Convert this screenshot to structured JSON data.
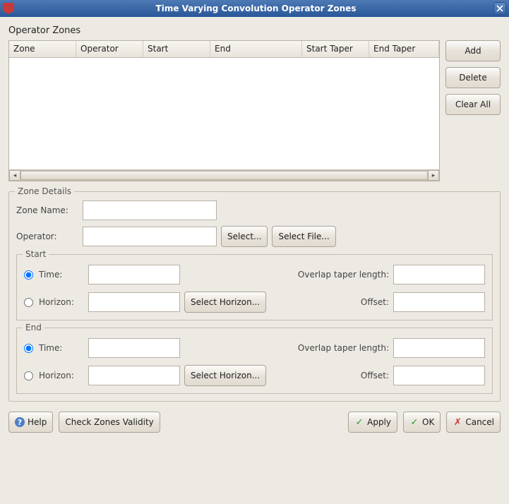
{
  "window": {
    "title": "Time Varying Convolution Operator Zones"
  },
  "operatorZones": {
    "label": "Operator Zones",
    "columns": {
      "zone": "Zone",
      "operator": "Operator",
      "start": "Start",
      "end": "End",
      "startTaper": "Start Taper",
      "endTaper": "End Taper"
    },
    "rows": [],
    "buttons": {
      "add": "Add",
      "delete": "Delete",
      "clearAll": "Clear All"
    }
  },
  "zoneDetails": {
    "legend": "Zone Details",
    "zoneName": {
      "label": "Zone Name:",
      "value": ""
    },
    "operator": {
      "label": "Operator:",
      "value": "",
      "selectBtn": "Select...",
      "selectFileBtn": "Select File..."
    },
    "start": {
      "legend": "Start",
      "timeLabel": "Time:",
      "timeValue": "",
      "timeSelected": true,
      "horizonLabel": "Horizon:",
      "horizonValue": "",
      "horizonSelected": false,
      "selectHorizonBtn": "Select Horizon...",
      "overlapLabel": "Overlap taper length:",
      "overlapValue": "",
      "offsetLabel": "Offset:",
      "offsetValue": ""
    },
    "end": {
      "legend": "End",
      "timeLabel": "Time:",
      "timeValue": "",
      "timeSelected": true,
      "horizonLabel": "Horizon:",
      "horizonValue": "",
      "horizonSelected": false,
      "selectHorizonBtn": "Select Horizon...",
      "overlapLabel": "Overlap taper length:",
      "overlapValue": "",
      "offsetLabel": "Offset:",
      "offsetValue": ""
    }
  },
  "bottom": {
    "help": "Help",
    "checkValidity": "Check Zones Validity",
    "apply": "Apply",
    "ok": "OK",
    "cancel": "Cancel"
  }
}
